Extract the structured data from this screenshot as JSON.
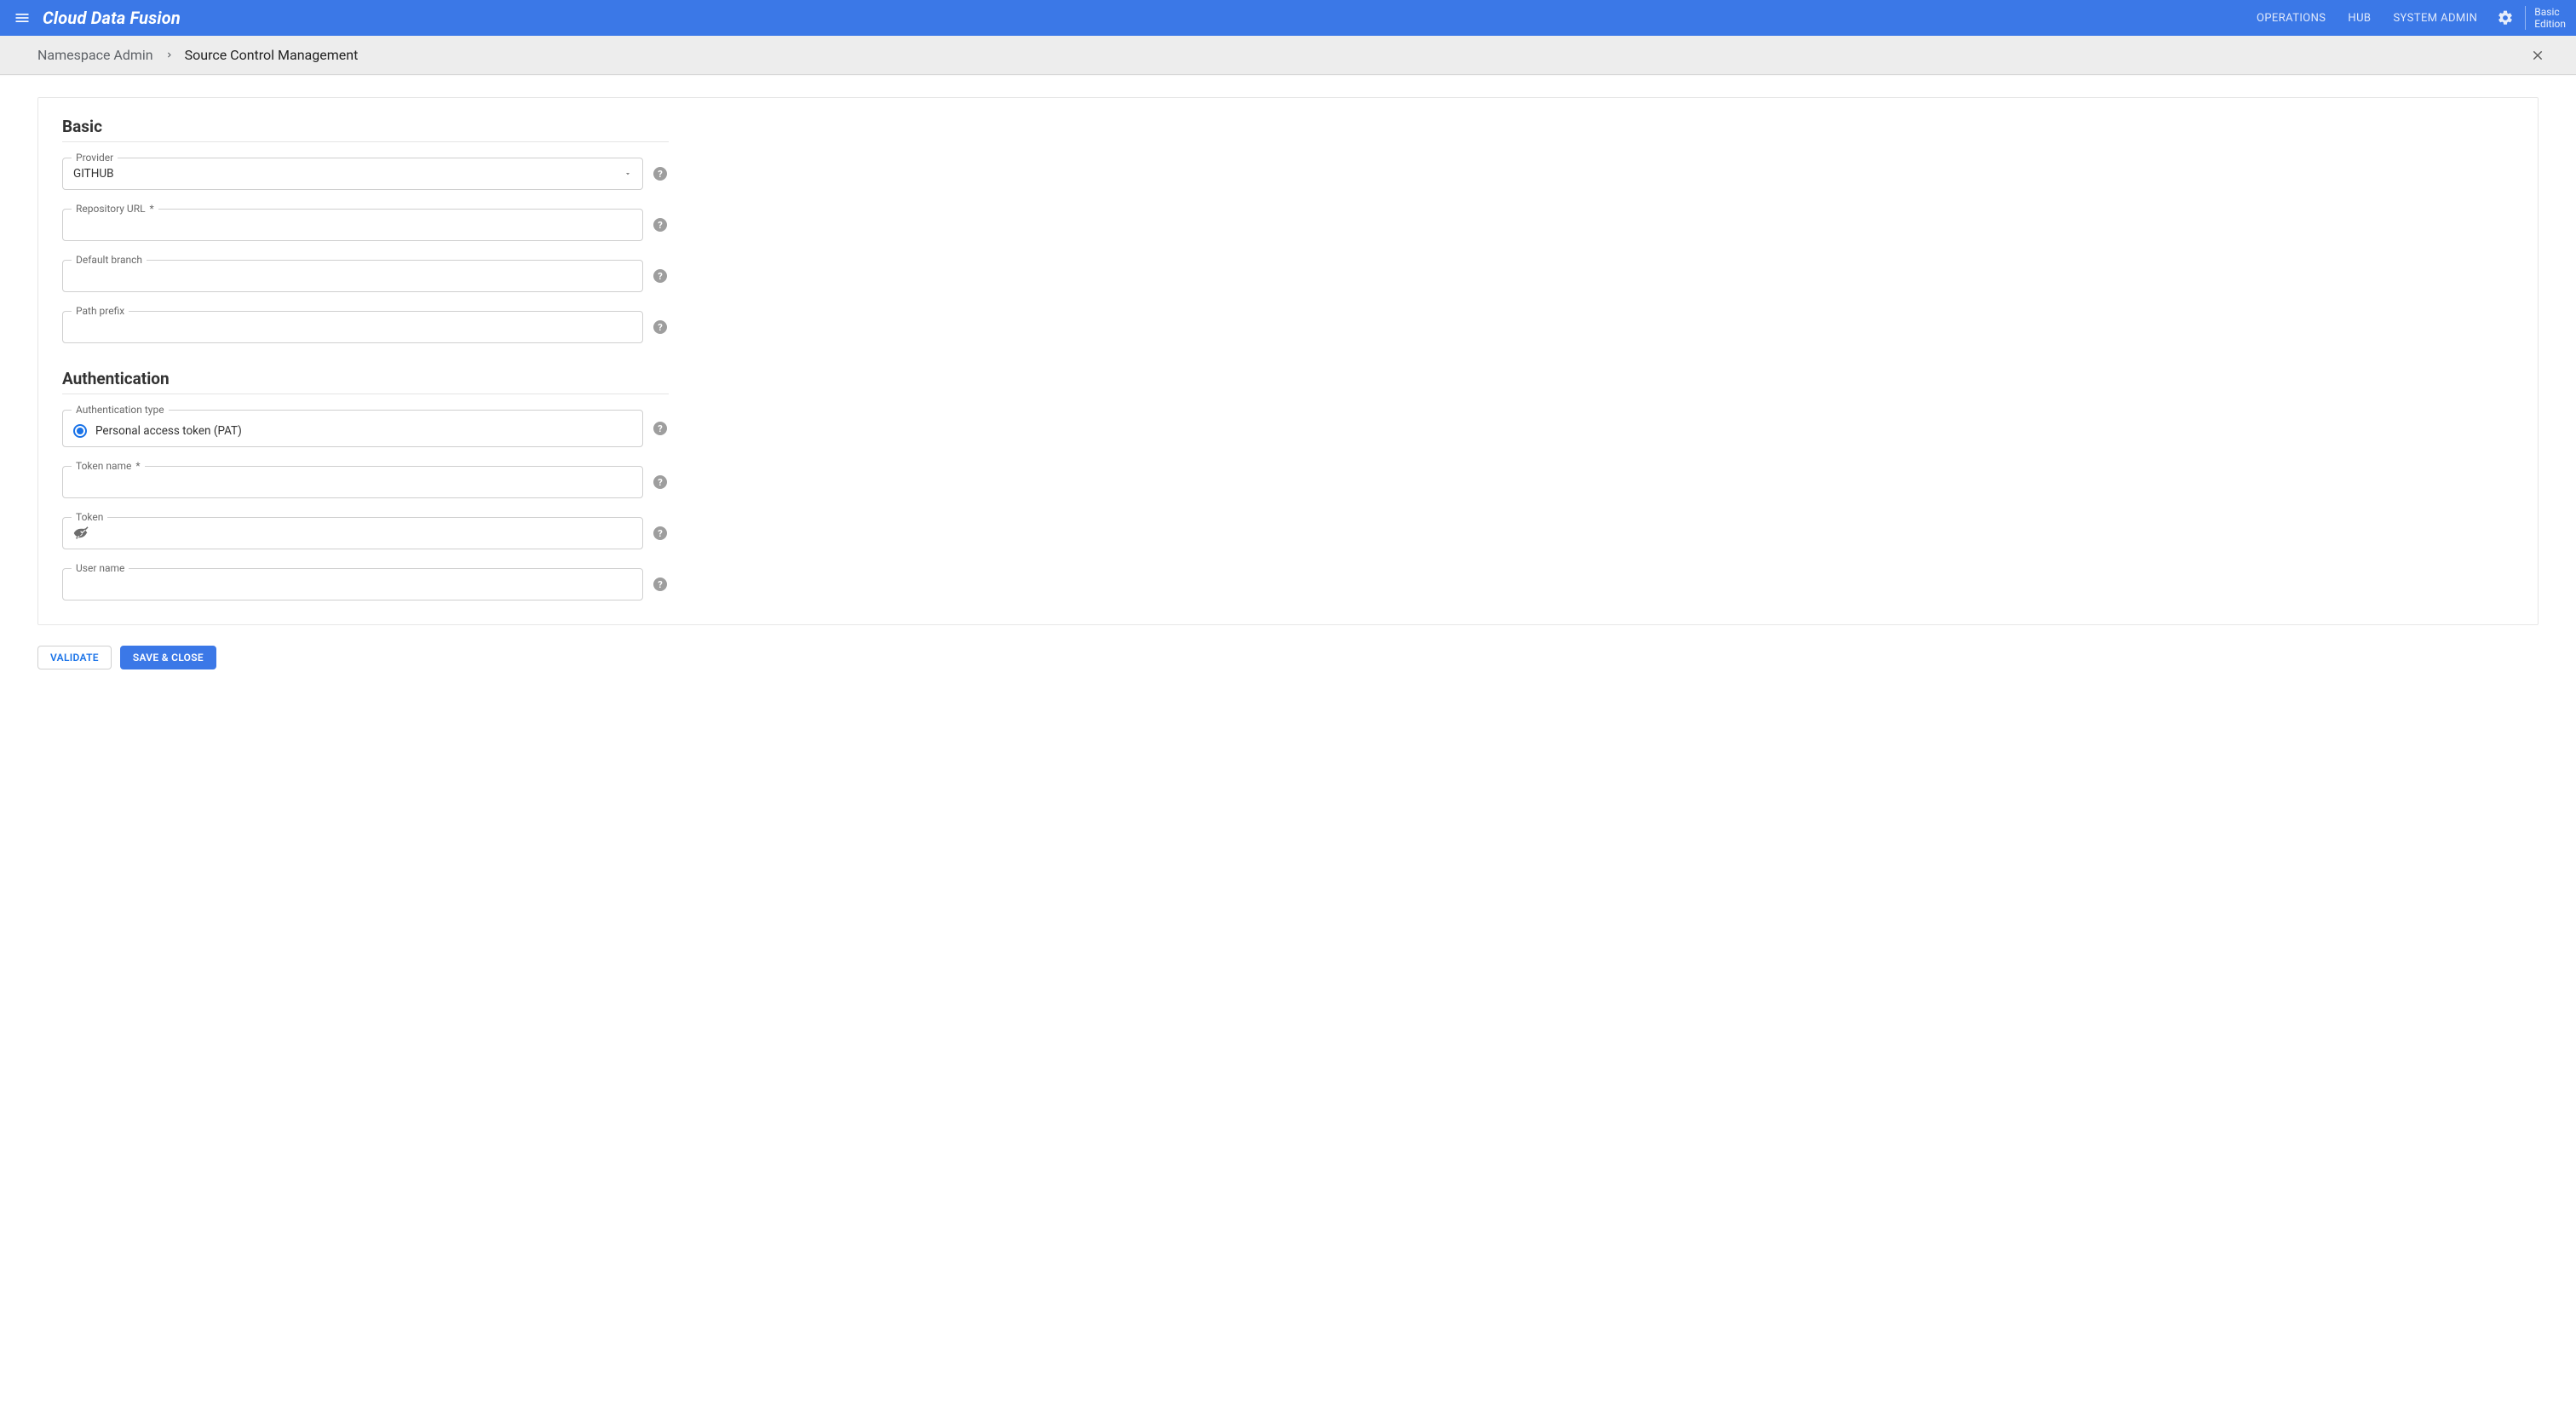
{
  "header": {
    "brand": "Cloud Data Fusion",
    "nav": [
      "OPERATIONS",
      "HUB",
      "SYSTEM ADMIN"
    ],
    "edition_line1": "Basic",
    "edition_line2": "Edition"
  },
  "breadcrumb": {
    "prev": "Namespace Admin",
    "current": "Source Control Management"
  },
  "sections": {
    "basic": {
      "title": "Basic",
      "provider_label": "Provider",
      "provider_value": "GITHUB",
      "repo_url_label": "Repository URL",
      "repo_url_value": "",
      "default_branch_label": "Default branch",
      "default_branch_value": "",
      "path_prefix_label": "Path prefix",
      "path_prefix_value": ""
    },
    "auth": {
      "title": "Authentication",
      "auth_type_label": "Authentication type",
      "auth_type_option": "Personal access token (PAT)",
      "token_name_label": "Token name",
      "token_name_value": "",
      "token_label": "Token",
      "token_value": "",
      "user_name_label": "User name",
      "user_name_value": ""
    }
  },
  "buttons": {
    "validate": "VALIDATE",
    "save_close": "SAVE & CLOSE"
  }
}
